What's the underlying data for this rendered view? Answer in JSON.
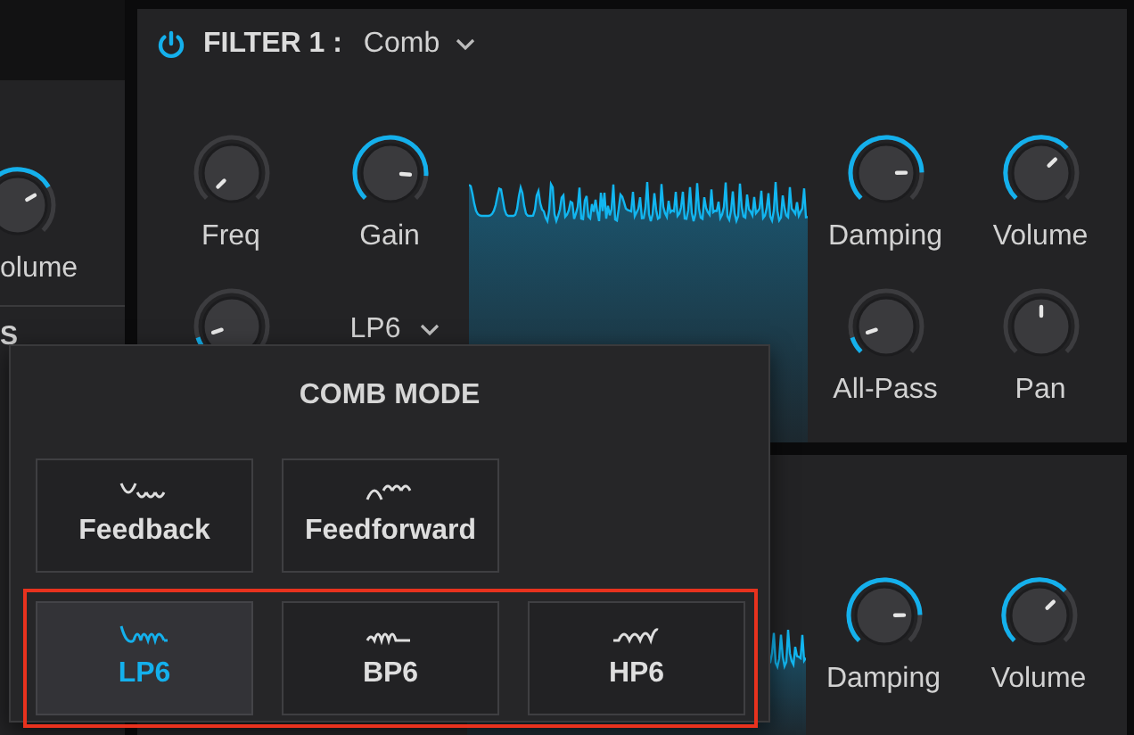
{
  "left_panel": {
    "knob": {
      "label": "olume"
    },
    "section_label": "S"
  },
  "filter_panel": {
    "power_on": true,
    "title": "FILTER 1 :",
    "type": "Comb",
    "left_knobs": [
      {
        "label": "Freq"
      },
      {
        "label": "Gain"
      }
    ],
    "slope_select": "LP6",
    "right_knobs": [
      {
        "label": "Damping"
      },
      {
        "label": "Volume"
      },
      {
        "label": "All-Pass"
      },
      {
        "label": "Pan"
      }
    ]
  },
  "second_panel": {
    "knobs": [
      {
        "label": "Damping"
      },
      {
        "label": "Volume"
      }
    ]
  },
  "comb_mode_popup": {
    "title": "COMB MODE",
    "rows": [
      {
        "highlighted": false,
        "options": [
          {
            "label": "Feedback",
            "selected": false
          },
          {
            "label": "Feedforward",
            "selected": false
          }
        ]
      },
      {
        "highlighted": true,
        "options": [
          {
            "label": "LP6",
            "selected": true
          },
          {
            "label": "BP6",
            "selected": false
          },
          {
            "label": "HP6",
            "selected": false
          }
        ]
      }
    ]
  }
}
